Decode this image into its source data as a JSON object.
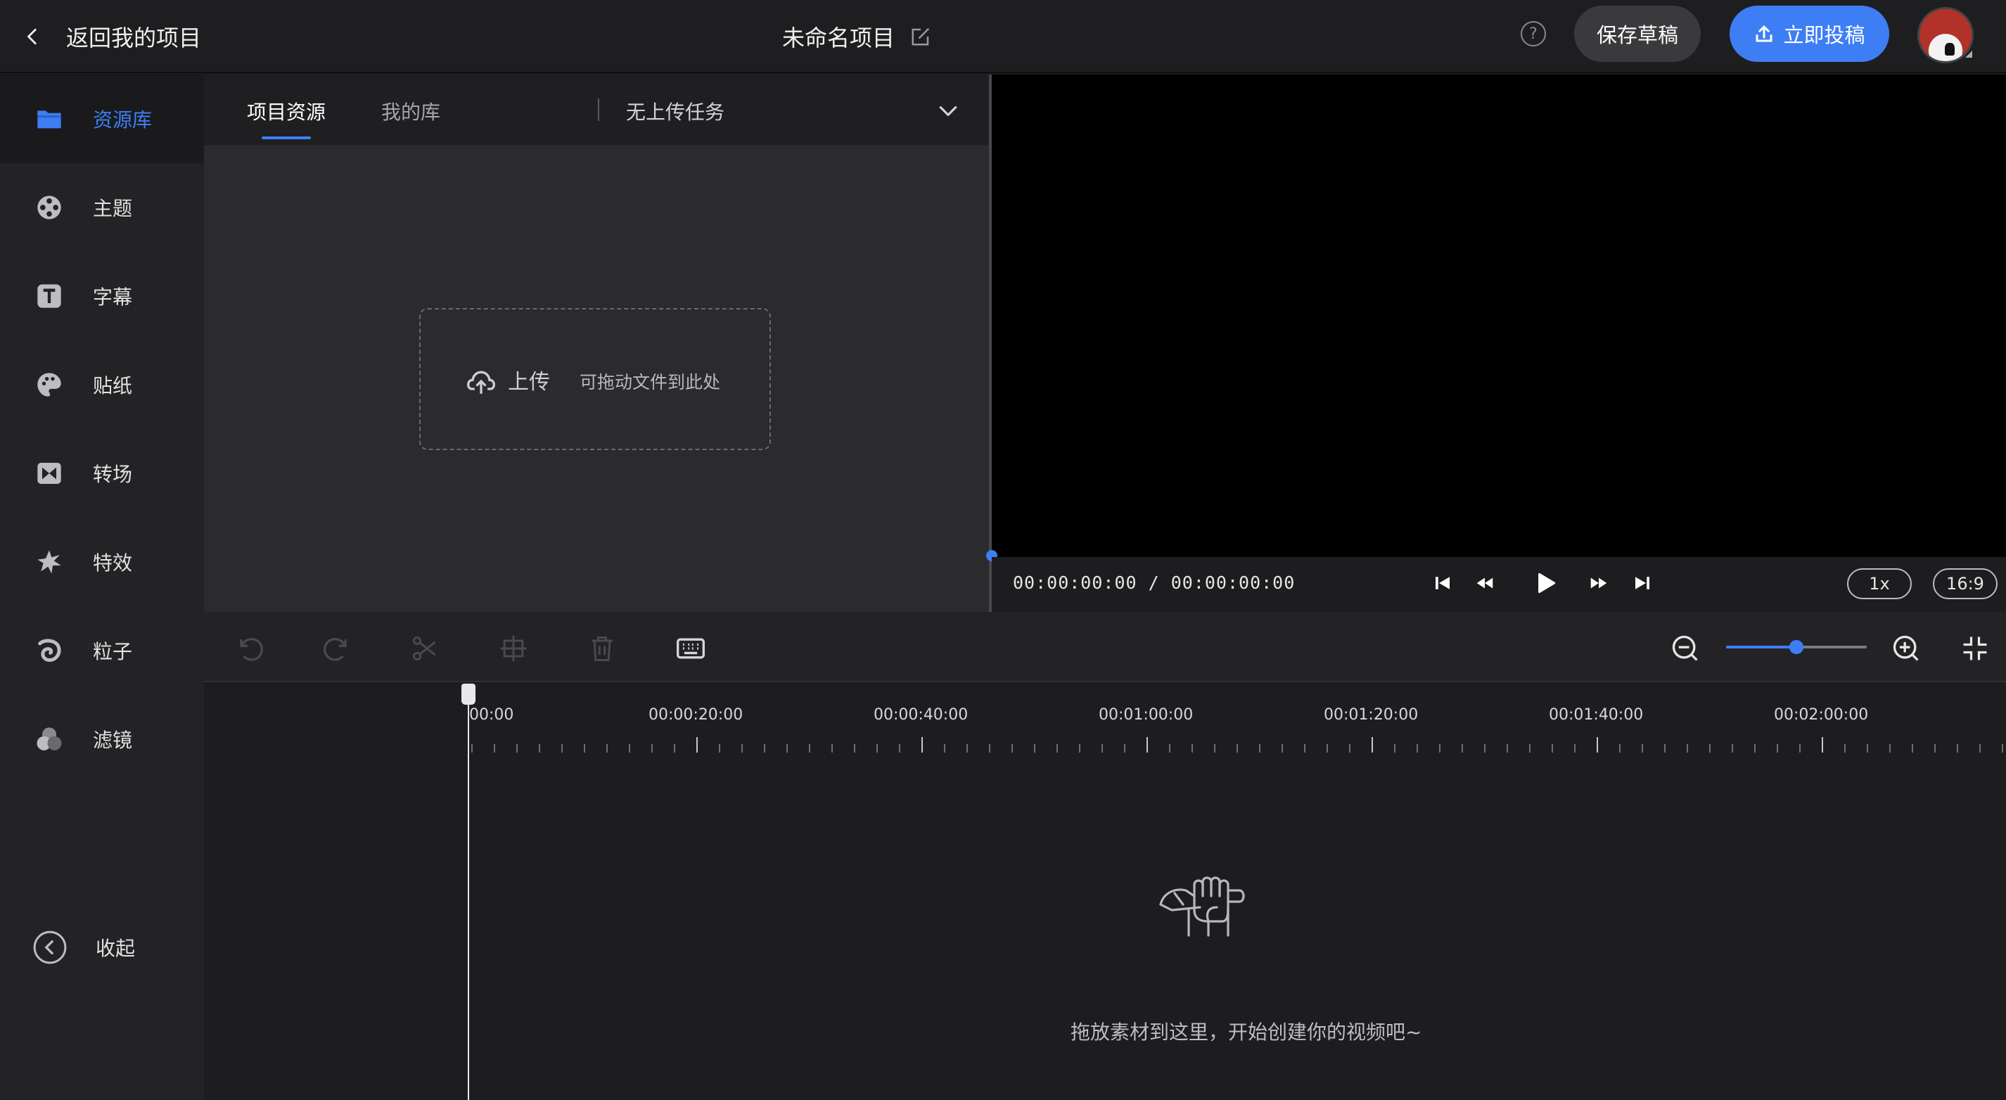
{
  "topbar": {
    "back_label": "返回我的项目",
    "project_title": "未命名项目",
    "help_symbol": "?",
    "save_draft_label": "保存草稿",
    "publish_label": "立即投稿"
  },
  "sidebar": {
    "items": [
      {
        "label": "资源库",
        "icon": "folder-icon",
        "active": true
      },
      {
        "label": "主题",
        "icon": "film-reel-icon"
      },
      {
        "label": "字幕",
        "icon": "text-t-icon"
      },
      {
        "label": "贴纸",
        "icon": "palette-icon"
      },
      {
        "label": "转场",
        "icon": "transition-icon"
      },
      {
        "label": "特效",
        "icon": "burst-icon"
      },
      {
        "label": "粒子",
        "icon": "swirl-icon"
      },
      {
        "label": "滤镜",
        "icon": "filter-circles-icon"
      }
    ],
    "collapse_label": "收起"
  },
  "resource": {
    "tabs": [
      "项目资源",
      "我的库"
    ],
    "active_tab": "项目资源",
    "upload_status": "无上传任务",
    "upload_label": "上传",
    "upload_hint": "可拖动文件到此处"
  },
  "player": {
    "timecode": "00:00:00:00 / 00:00:00:00",
    "speed": "1x",
    "aspect": "16:9"
  },
  "timeline": {
    "ruler_labels": [
      "00:00",
      "00:00:20:00",
      "00:00:40:00",
      "00:01:00:00",
      "00:01:20:00",
      "00:01:40:00",
      "00:02:00:00"
    ],
    "zoom_level": 0.5,
    "empty_text": "拖放素材到这里，开始创建你的视频吧~"
  },
  "colors": {
    "accent": "#3d7ef5",
    "background": "#1c1c1e"
  }
}
